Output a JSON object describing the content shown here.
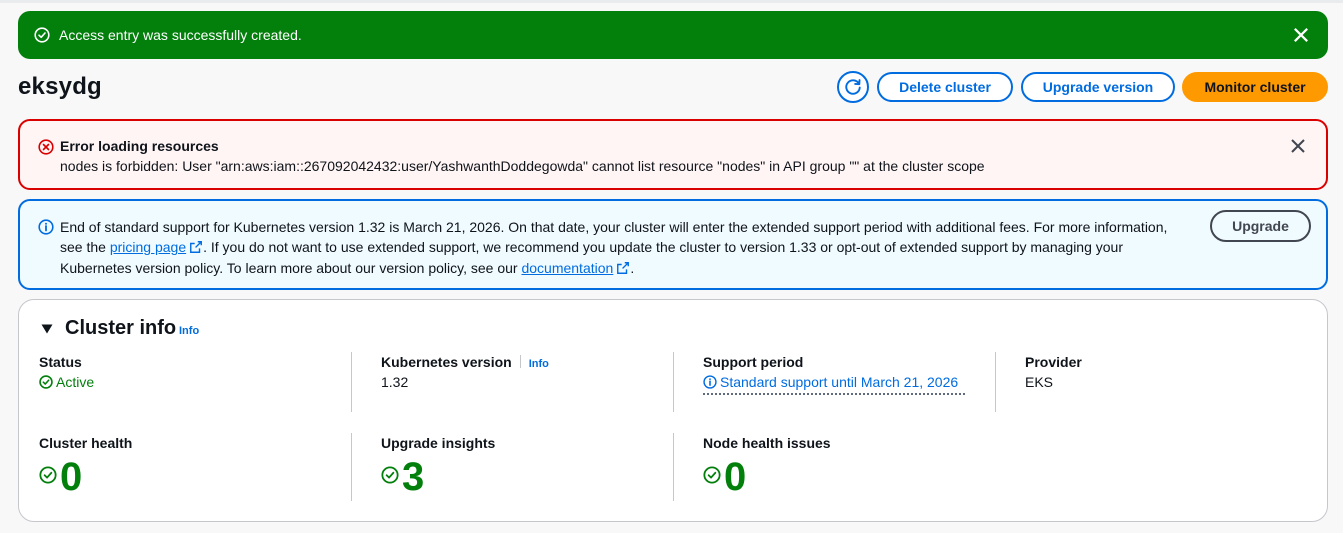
{
  "flash": {
    "message": "Access entry was successfully created."
  },
  "header": {
    "title": "eksydg",
    "delete_label": "Delete cluster",
    "upgrade_version_label": "Upgrade version",
    "monitor_label": "Monitor cluster"
  },
  "error_alert": {
    "heading": "Error loading resources",
    "message": "nodes is forbidden: User \"arn:aws:iam::267092042432:user/YashwanthDoddegowda\" cannot list resource \"nodes\" in API group \"\" at the cluster scope"
  },
  "info_alert": {
    "text_1": "End of standard support for Kubernetes version 1.32 is March 21, 2026. On that date, your cluster will enter the extended support period with additional fees. For more information, see the ",
    "pricing_link": "pricing page",
    "text_2": ". If you do not want to use extended support, we recommend you update the cluster to version 1.33 or opt-out of extended support by managing your Kubernetes version policy. To learn more about our version policy, see our ",
    "docs_link": "documentation",
    "text_3": ".",
    "button_label": "Upgrade"
  },
  "cluster_info": {
    "title": "Cluster info",
    "info_label": "Info",
    "status": {
      "label": "Status",
      "value": "Active"
    },
    "kubernetes_version": {
      "label": "Kubernetes version",
      "info_label": "Info",
      "value": "1.32"
    },
    "support_period": {
      "label": "Support period",
      "value": "Standard support until March 21, 2026"
    },
    "provider": {
      "label": "Provider",
      "value": "EKS"
    },
    "cluster_health": {
      "label": "Cluster health",
      "value": "0"
    },
    "upgrade_insights": {
      "label": "Upgrade insights",
      "value": "3"
    },
    "node_health_issues": {
      "label": "Node health issues",
      "value": "0"
    }
  },
  "colors": {
    "success": "#037f0c",
    "error": "#db0000",
    "info": "#006ce0",
    "primary_button": "#ff9900"
  }
}
